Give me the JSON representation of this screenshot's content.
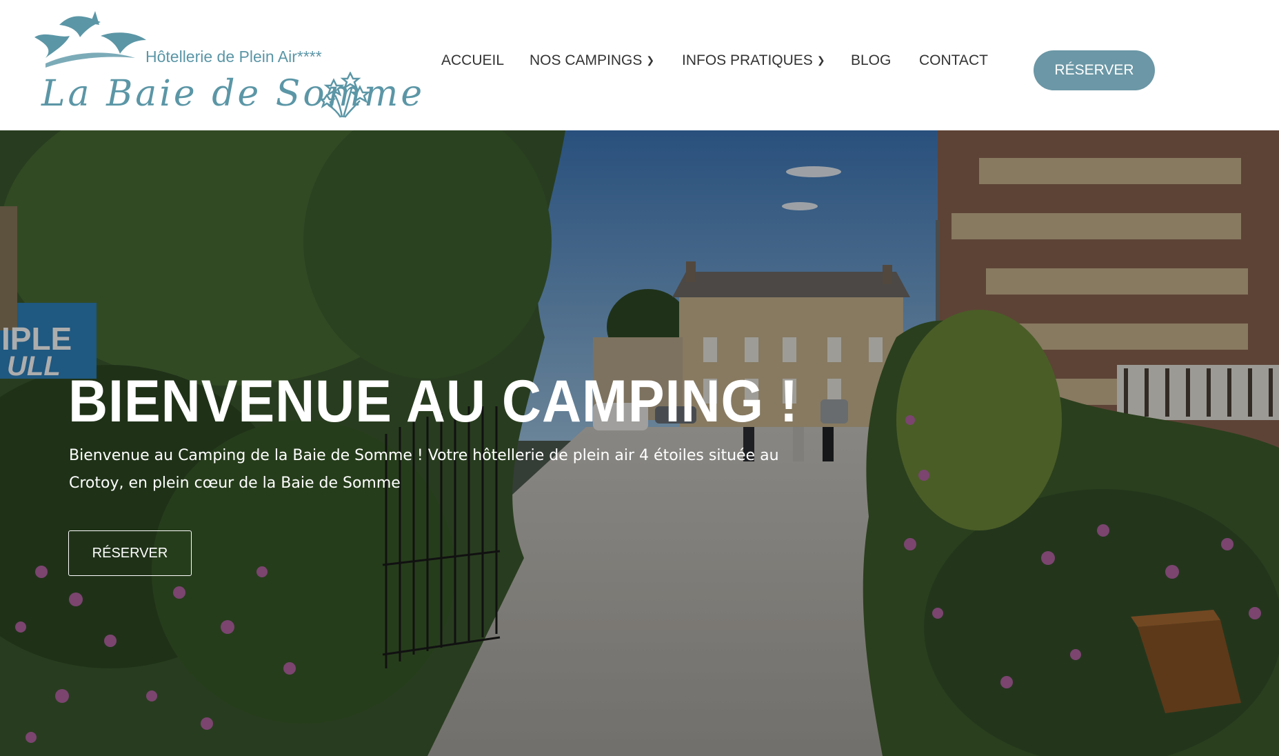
{
  "header": {
    "logo": {
      "tagline": "Hôtellerie de Plein Air****",
      "name": "La Baie de Somme"
    },
    "nav": {
      "items": [
        {
          "label": "ACCUEIL",
          "dropdown": false
        },
        {
          "label": "NOS CAMPINGS",
          "dropdown": true
        },
        {
          "label": "INFOS PRATIQUES",
          "dropdown": true
        },
        {
          "label": "BLOG",
          "dropdown": false
        },
        {
          "label": "CONTACT",
          "dropdown": false
        }
      ]
    },
    "cta_label": "RÉSERVER"
  },
  "hero": {
    "title": "BIENVENUE AU CAMPING !",
    "subtitle": "Bienvenue au Camping de la Baie de Somme ! Votre hôtellerie de plein air 4 étoiles située au Crotoy, en plein cœur de la Baie de Somme",
    "button_label": "RÉSERVER",
    "sign_text": "IPLE ULL"
  },
  "colors": {
    "brand": "#5b96a6",
    "cta_bg": "#6b97a6",
    "nav_text": "#333333"
  },
  "icons": {
    "dropdown": "chevron-down-icon",
    "logo_birds": "birds-icon",
    "logo_flower": "flower-icon"
  }
}
